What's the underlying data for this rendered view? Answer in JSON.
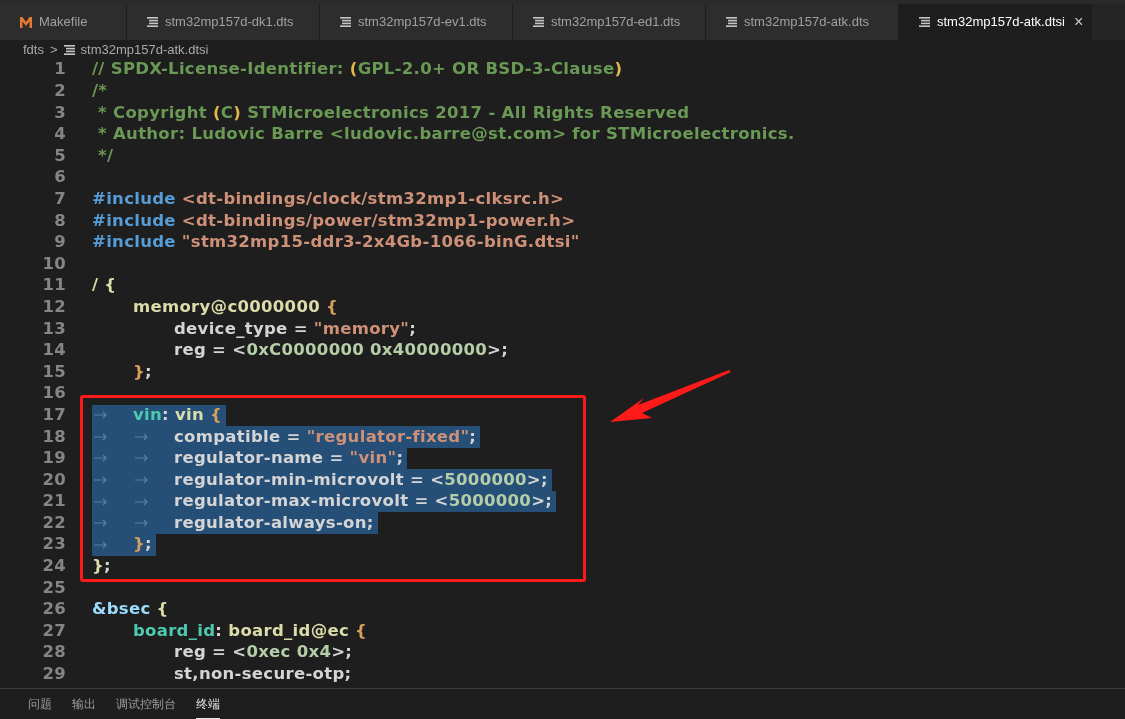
{
  "tabs": [
    {
      "label": "Makefile",
      "kind": "makefile",
      "selected": false
    },
    {
      "label": "stm32mp157d-dk1.dts",
      "kind": "file",
      "selected": false
    },
    {
      "label": "stm32mp157d-ev1.dts",
      "kind": "file",
      "selected": false
    },
    {
      "label": "stm32mp157d-ed1.dts",
      "kind": "file",
      "selected": false
    },
    {
      "label": "stm32mp157d-atk.dts",
      "kind": "file",
      "selected": false
    },
    {
      "label": "stm32mp157d-atk.dtsi",
      "kind": "file",
      "selected": true,
      "close": "×"
    }
  ],
  "breadcrumb": {
    "folder": "fdts",
    "separator": ">",
    "file": "stm32mp157d-atk.dtsi"
  },
  "lines": [
    {
      "number": "1",
      "selected": false,
      "tokens": [
        {
          "kind": "comment",
          "text": "// SPDX-License-Identifier: "
        },
        {
          "kind": "paren",
          "text": "("
        },
        {
          "kind": "comment",
          "text": "GPL-2.0+ OR BSD-3-Clause"
        },
        {
          "kind": "paren",
          "text": ")"
        }
      ]
    },
    {
      "number": "2",
      "selected": false,
      "tokens": [
        {
          "kind": "comment",
          "text": "/*"
        }
      ]
    },
    {
      "number": "3",
      "selected": false,
      "tokens": [
        {
          "kind": "comment",
          "text": " * Copyright "
        },
        {
          "kind": "paren",
          "text": "("
        },
        {
          "kind": "comment",
          "text": "C"
        },
        {
          "kind": "paren",
          "text": ")"
        },
        {
          "kind": "comment",
          "text": " STMicroelectronics 2017 - All Rights Reserved"
        }
      ]
    },
    {
      "number": "4",
      "selected": false,
      "tokens": [
        {
          "kind": "comment",
          "text": " * Author: Ludovic Barre <ludovic.barre@st.com> for STMicroelectronics."
        }
      ]
    },
    {
      "number": "5",
      "selected": false,
      "tokens": [
        {
          "kind": "comment",
          "text": " */"
        }
      ]
    },
    {
      "number": "6",
      "selected": false
    },
    {
      "number": "7",
      "selected": false,
      "tokens": [
        {
          "kind": "keyword",
          "text": "#include "
        },
        {
          "kind": "string",
          "text": "<dt-bindings/clock/stm32mp1-clksrc.h>"
        }
      ]
    },
    {
      "number": "8",
      "selected": false,
      "tokens": [
        {
          "kind": "keyword",
          "text": "#include "
        },
        {
          "kind": "string",
          "text": "<dt-bindings/power/stm32mp1-power.h>"
        }
      ]
    },
    {
      "number": "9",
      "selected": false,
      "tokens": [
        {
          "kind": "keyword",
          "text": "#include "
        },
        {
          "kind": "string",
          "text": "\"stm32mp15-ddr3-2x4Gb-1066-binG.dtsi\""
        }
      ]
    },
    {
      "number": "10",
      "selected": false
    },
    {
      "number": "11",
      "selected": false,
      "tokens": [
        {
          "kind": "node",
          "text": "/ {"
        }
      ],
      "children": [
        {
          "number": "12",
          "selected": false,
          "tokens": [
            {
              "kind": "node",
              "text": "memory@c0000000"
            },
            {
              "kind": "brace",
              "text": " {"
            }
          ],
          "children": [
            {
              "number": "13",
              "selected": false,
              "tokens": [
                {
                  "kind": "prop",
                  "text": "device_type"
                },
                {
                  "kind": "punct",
                  "text": " = "
                },
                {
                  "kind": "string",
                  "text": "\"memory\""
                },
                {
                  "kind": "punct",
                  "text": ";"
                }
              ]
            },
            {
              "number": "14",
              "selected": false,
              "tokens": [
                {
                  "kind": "prop",
                  "text": "reg"
                },
                {
                  "kind": "punct",
                  "text": " = <"
                },
                {
                  "kind": "number",
                  "text": "0xC0000000 0x40000000"
                },
                {
                  "kind": "punct",
                  "text": ">;"
                }
              ]
            }
          ]
        },
        {
          "number": "15",
          "selected": false,
          "tokens": [
            {
              "kind": "brace",
              "text": "}"
            },
            {
              "kind": "punct",
              "text": ";"
            }
          ]
        },
        {
          "number": "16",
          "selected": false
        },
        {
          "number": "17",
          "selected": true,
          "tokens": [
            {
              "kind": "label",
              "text": "vin"
            },
            {
              "kind": "punct",
              "text": ": "
            },
            {
              "kind": "node",
              "text": "vin"
            },
            {
              "kind": "brace",
              "text": " {"
            }
          ],
          "children": [
            {
              "number": "18",
              "selected": true,
              "tokens": [
                {
                  "kind": "prop",
                  "text": "compatible"
                },
                {
                  "kind": "punct",
                  "text": " = "
                },
                {
                  "kind": "string",
                  "text": "\"regulator-fixed\""
                },
                {
                  "kind": "punct",
                  "text": ";"
                }
              ]
            },
            {
              "number": "19",
              "selected": true,
              "tokens": [
                {
                  "kind": "prop",
                  "text": "regulator-name"
                },
                {
                  "kind": "punct",
                  "text": " = "
                },
                {
                  "kind": "string",
                  "text": "\"vin\""
                },
                {
                  "kind": "punct",
                  "text": ";"
                }
              ]
            },
            {
              "number": "20",
              "selected": true,
              "tokens": [
                {
                  "kind": "prop",
                  "text": "regulator-min-microvolt"
                },
                {
                  "kind": "punct",
                  "text": " = <"
                },
                {
                  "kind": "number",
                  "text": "5000000"
                },
                {
                  "kind": "punct",
                  "text": ">;"
                }
              ]
            },
            {
              "number": "21",
              "selected": true,
              "tokens": [
                {
                  "kind": "prop",
                  "text": "regulator-max-microvolt"
                },
                {
                  "kind": "punct",
                  "text": " = <"
                },
                {
                  "kind": "number",
                  "text": "5000000"
                },
                {
                  "kind": "punct",
                  "text": ">;"
                }
              ]
            },
            {
              "number": "22",
              "selected": true,
              "tokens": [
                {
                  "kind": "prop",
                  "text": "regulator-always-on;"
                }
              ]
            }
          ]
        },
        {
          "number": "23",
          "selected": true,
          "tokens": [
            {
              "kind": "brace",
              "text": "}"
            },
            {
              "kind": "punct",
              "text": ";"
            }
          ]
        }
      ]
    },
    {
      "number": "24",
      "selected": false,
      "tokens": [
        {
          "kind": "node",
          "text": "}"
        },
        {
          "kind": "punct",
          "text": ";"
        }
      ]
    },
    {
      "number": "25",
      "selected": false
    },
    {
      "number": "26",
      "selected": false,
      "tokens": [
        {
          "kind": "ref",
          "text": "&bsec"
        },
        {
          "kind": "node",
          "text": " {"
        }
      ],
      "children": [
        {
          "number": "27",
          "selected": false,
          "tokens": [
            {
              "kind": "label",
              "text": "board_id"
            },
            {
              "kind": "punct",
              "text": ": "
            },
            {
              "kind": "node",
              "text": "board_id@ec"
            },
            {
              "kind": "brace",
              "text": " {"
            }
          ],
          "children": [
            {
              "number": "28",
              "selected": false,
              "tokens": [
                {
                  "kind": "prop",
                  "text": "reg"
                },
                {
                  "kind": "punct",
                  "text": " = <"
                },
                {
                  "kind": "number",
                  "text": "0xec 0x4"
                },
                {
                  "kind": "punct",
                  "text": ">;"
                }
              ]
            },
            {
              "number": "29",
              "selected": false,
              "tokens": [
                {
                  "kind": "prop",
                  "text": "st,non-secure-otp;"
                }
              ]
            }
          ]
        }
      ]
    }
  ],
  "panel_tabs": [
    {
      "label": "问题",
      "selected": false
    },
    {
      "label": "输出",
      "selected": false
    },
    {
      "label": "调试控制台",
      "selected": false
    },
    {
      "label": "终端",
      "selected": true
    }
  ]
}
